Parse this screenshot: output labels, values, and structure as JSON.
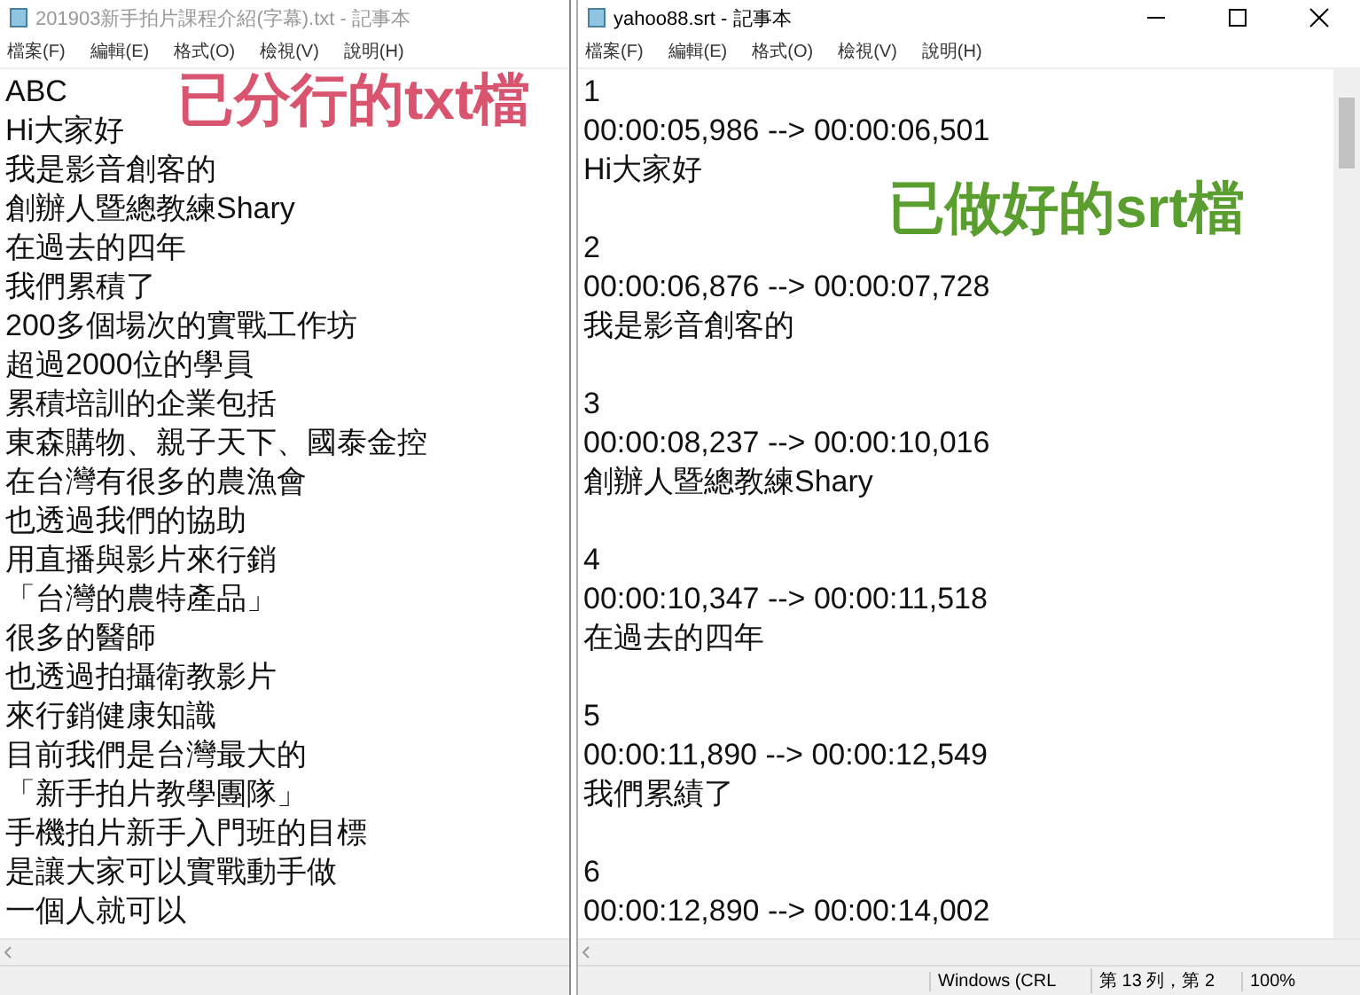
{
  "windows": [
    {
      "title": "201903新手拍片課程介紹(字幕).txt - 記事本",
      "active": false,
      "menu": [
        "檔案(F)",
        "編輯(E)",
        "格式(O)",
        "檢視(V)",
        "說明(H)"
      ],
      "annotation": {
        "text": "已分行的txt檔",
        "color": "#d9546e"
      },
      "lines": [
        "ABC",
        "Hi大家好",
        "我是影音創客的",
        "創辦人暨總教練Shary",
        "在過去的四年",
        "我們累積了",
        "200多個場次的實戰工作坊",
        "超過2000位的學員",
        "累積培訓的企業包括",
        "東森購物、親子天下、國泰金控",
        "在台灣有很多的農漁會",
        "也透過我們的協助",
        "用直播與影片來行銷",
        "「台灣的農特產品」",
        "很多的醫師",
        "也透過拍攝衛教影片",
        "來行銷健康知識",
        "目前我們是台灣最大的",
        "「新手拍片教學團隊」",
        "手機拍片新手入門班的目標",
        "是讓大家可以實戰動手做",
        "一個人就可以"
      ]
    },
    {
      "title": "yahoo88.srt - 記事本",
      "active": true,
      "menu": [
        "檔案(F)",
        "編輯(E)",
        "格式(O)",
        "檢視(V)",
        "說明(H)"
      ],
      "annotation": {
        "text": "已做好的srt檔",
        "color": "#5a9e2f"
      },
      "entries": [
        {
          "index": "1",
          "time": "00:00:05,986 --> 00:00:06,501",
          "text": "Hi大家好"
        },
        {
          "index": "2",
          "time": "00:00:06,876 --> 00:00:07,728",
          "text": "我是影音創客的"
        },
        {
          "index": "3",
          "time": "00:00:08,237 --> 00:00:10,016",
          "text": "創辦人暨總教練Shary"
        },
        {
          "index": "4",
          "time": "00:00:10,347 --> 00:00:11,518",
          "text": "在過去的四年"
        },
        {
          "index": "5",
          "time": "00:00:11,890 --> 00:00:12,549",
          "text": "我們累績了"
        },
        {
          "index": "6",
          "time": "00:00:12,890 --> 00:00:14,002"
        }
      ],
      "status": [
        "Windows (CRL",
        "第 13 列，第 2",
        "100%"
      ]
    }
  ]
}
